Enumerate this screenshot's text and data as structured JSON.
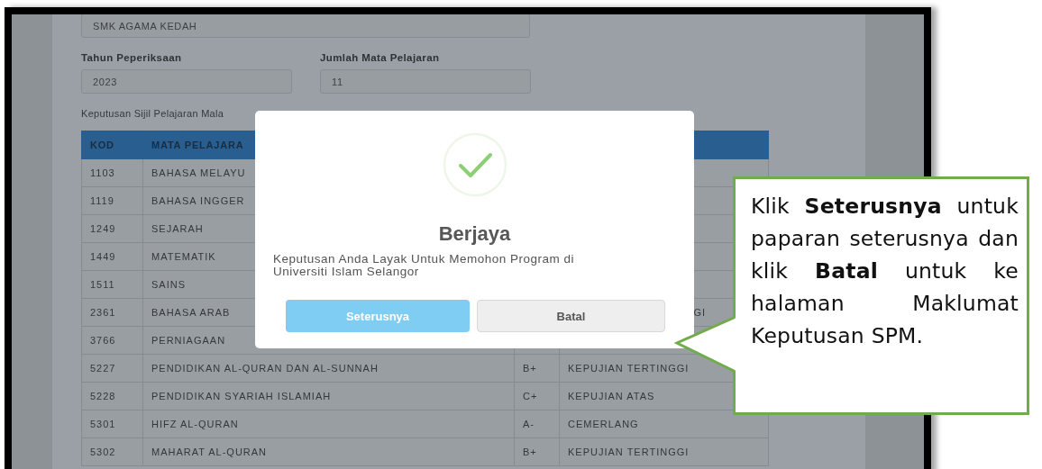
{
  "school": {
    "value": "SMK AGAMA KEDAH"
  },
  "fields": [
    {
      "label": "Tahun Peperiksaan",
      "value": "2023"
    },
    {
      "label": "Jumlah Mata Pelajaran",
      "value": "11"
    }
  ],
  "results": {
    "caption": "Keputusan Sijil Pelajaran Mala",
    "columns": [
      "KOD",
      "MATA PELAJARA"
    ],
    "rows": [
      {
        "kod": "1103",
        "subject": "BAHASA MELAYU"
      },
      {
        "kod": "1119",
        "subject": "BAHASA INGGER"
      },
      {
        "kod": "1249",
        "subject": "SEJARAH"
      },
      {
        "kod": "1449",
        "subject": "MATEMATIK"
      },
      {
        "kod": "1511",
        "subject": "SAINS"
      },
      {
        "kod": "2361",
        "subject": "BAHASA ARAB",
        "description": "GI"
      },
      {
        "kod": "3766",
        "subject": "PERNIAGAAN"
      },
      {
        "kod": "5227",
        "subject": "PENDIDIKAN AL-QURAN DAN AL-SUNNAH",
        "grade": "B+",
        "description": "KEPUJIAN TERTINGGI"
      },
      {
        "kod": "5228",
        "subject": "PENDIDIKAN SYARIAH ISLAMIAH",
        "grade": "C+",
        "description": "KEPUJIAN ATAS"
      },
      {
        "kod": "5301",
        "subject": "HIFZ AL-QURAN",
        "grade": "A-",
        "description": "CEMERLANG"
      },
      {
        "kod": "5302",
        "subject": "MAHARAT AL-QURAN",
        "grade": "B+",
        "description": "KEPUJIAN TERTINGGI"
      }
    ]
  },
  "dialog": {
    "title": "Berjaya",
    "message": "Keputusan Anda Layak Untuk Memohon Program di Universiti Islam Selangor",
    "buttons": [
      {
        "label": "Seterusnya",
        "kind": "primary"
      },
      {
        "label": "Batal",
        "kind": "secondary"
      }
    ]
  },
  "callout": {
    "text": "Klik **Seterusnya** untuk paparan seterusnya dan klik **Batal** untuk ke halaman Maklumat Keputusan SPM."
  }
}
